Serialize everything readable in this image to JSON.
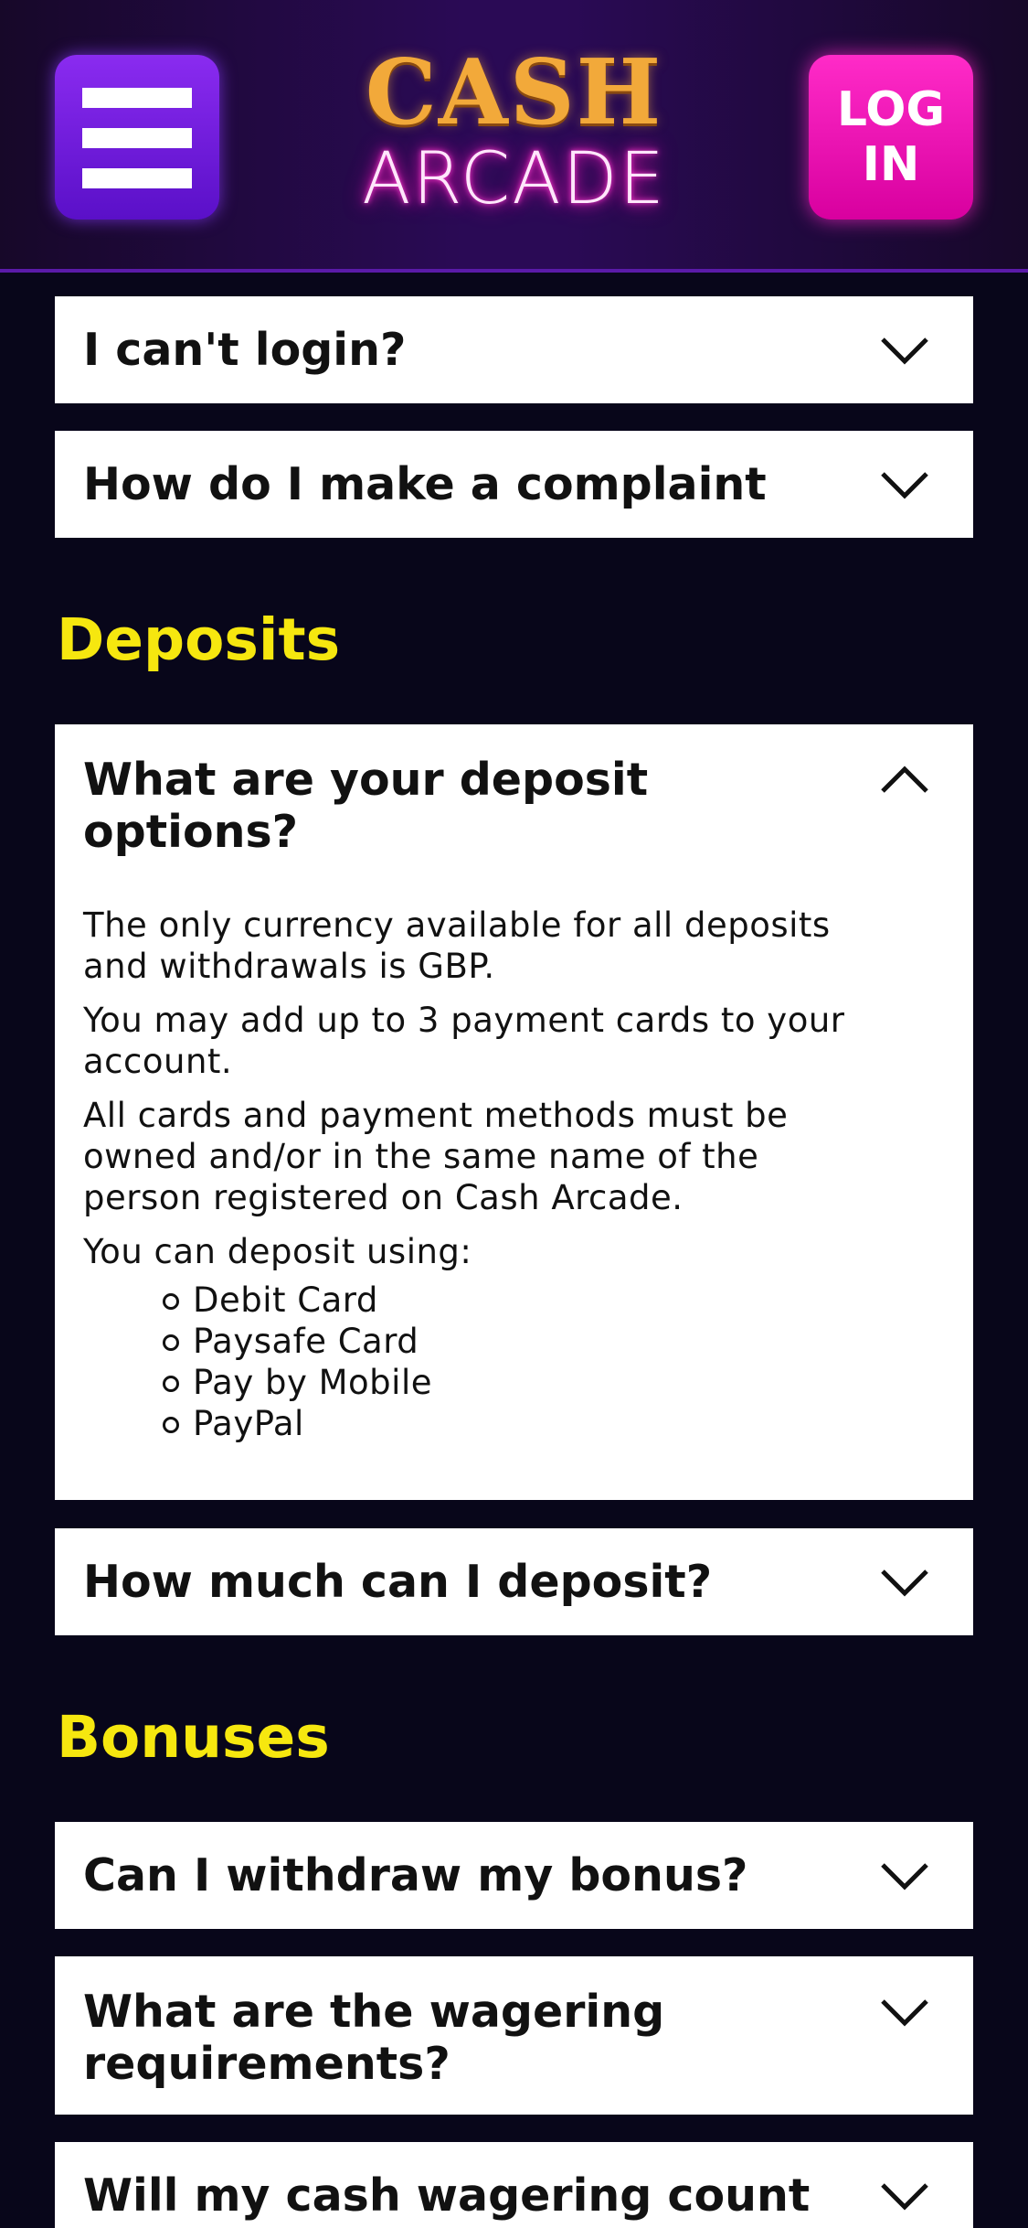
{
  "header": {
    "menu_icon": "hamburger-menu-icon",
    "logo": {
      "line1": "CASH",
      "line2": "ARCADE"
    },
    "login_label": "LOG IN"
  },
  "faq_top": [
    {
      "question": "I can't login?"
    },
    {
      "question": "How do I make a complaint"
    }
  ],
  "deposits": {
    "title": "Deposits",
    "expanded": {
      "question": "What are your deposit options?",
      "paragraphs": [
        "The only currency available for all deposits and withdrawals is GBP.",
        "You may add up to 3 payment cards to your account.",
        "All cards and payment methods must be owned and/or in the same name of the person registered on Cash Arcade.",
        "You can deposit using:"
      ],
      "methods": [
        "Debit Card",
        "Paysafe Card",
        "Pay by Mobile",
        "PayPal"
      ]
    },
    "collapsed": [
      {
        "question": "How much can I deposit?"
      }
    ]
  },
  "bonuses": {
    "title": "Bonuses",
    "items": [
      {
        "question": "Can I withdraw my bonus?"
      },
      {
        "question": "What are the wagering requirements?"
      },
      {
        "question": "Will my cash wagering count"
      }
    ]
  },
  "colors": {
    "page_background": "#08061a",
    "section_title": "#f6e70f",
    "menu_button": "#6a16d8",
    "login_button": "#ee14b8",
    "card_background": "#ffffff"
  },
  "icons": {
    "collapsed": "chevron-down-icon",
    "expanded": "chevron-up-icon"
  }
}
